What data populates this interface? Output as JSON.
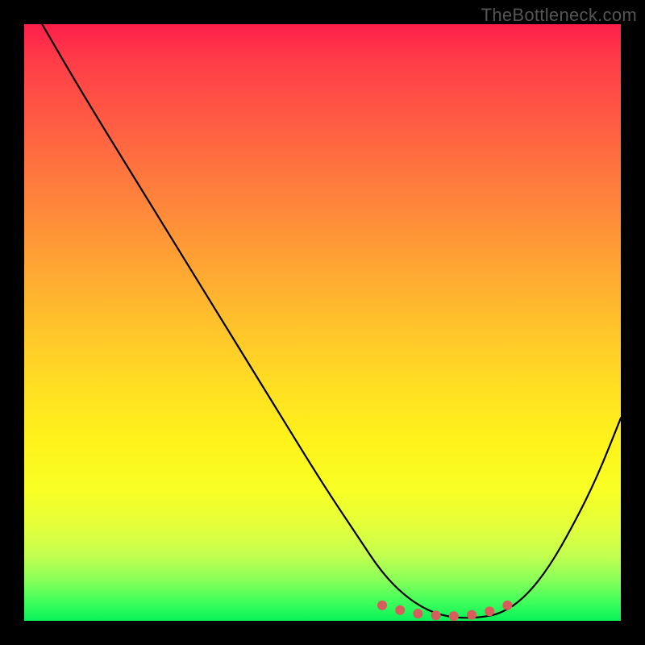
{
  "watermark": "TheBottleneck.com",
  "chart_data": {
    "type": "line",
    "title": "",
    "xlabel": "",
    "ylabel": "",
    "xlim": [
      0,
      100
    ],
    "ylim": [
      0,
      100
    ],
    "series": [
      {
        "name": "bottleneck-curve",
        "x": [
          3,
          10,
          18,
          26,
          34,
          42,
          50,
          56,
          60,
          64,
          68,
          72,
          76,
          80,
          84,
          88,
          92,
          96,
          100
        ],
        "y": [
          100,
          88,
          75,
          62,
          49,
          36,
          23,
          14,
          8,
          4,
          1.5,
          0.5,
          0.5,
          1.2,
          4,
          9,
          16,
          24,
          34
        ]
      }
    ],
    "markers": {
      "name": "minimum-region-dots",
      "x": [
        60,
        63,
        66,
        69,
        72,
        75,
        78,
        81
      ],
      "y": [
        2.6,
        1.8,
        1.2,
        0.9,
        0.8,
        1.0,
        1.6,
        2.6
      ]
    },
    "gradient_stops": [
      {
        "pos": 0,
        "color": "#ff1f4a"
      },
      {
        "pos": 50,
        "color": "#ffd228"
      },
      {
        "pos": 80,
        "color": "#fdff2a"
      },
      {
        "pos": 100,
        "color": "#08f158"
      }
    ]
  }
}
